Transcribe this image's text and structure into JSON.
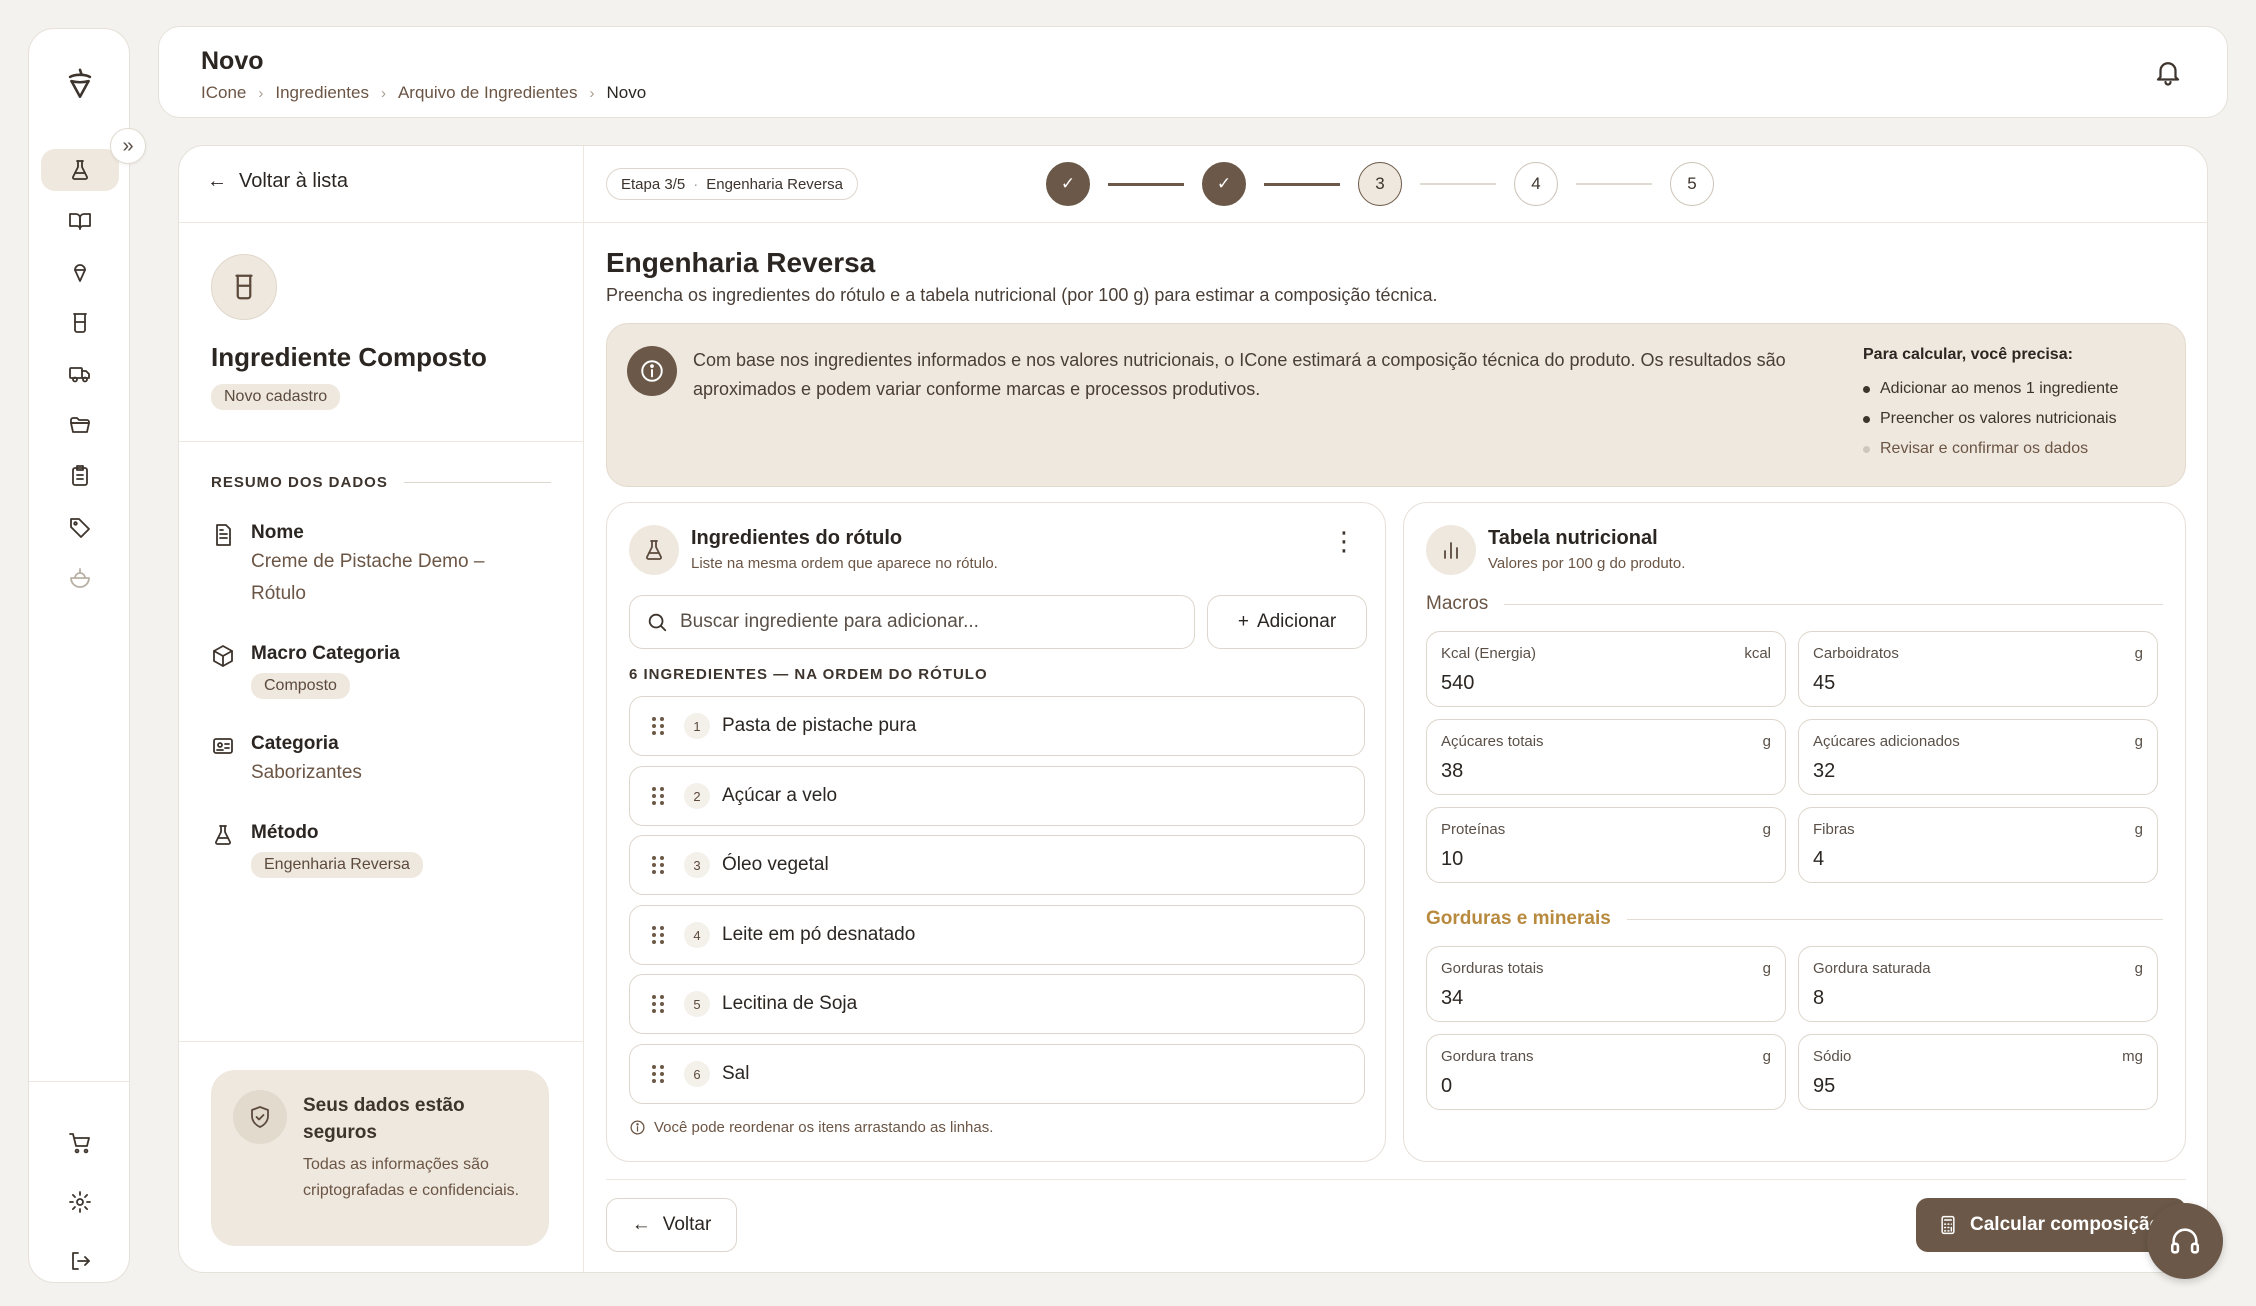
{
  "header": {
    "title": "Novo",
    "breadcrumb": [
      "ICone",
      "Ingredientes",
      "Arquivo de Ingredientes",
      "Novo"
    ]
  },
  "left_panel": {
    "back_label": "Voltar à lista",
    "title": "Ingrediente Composto",
    "status_pill": "Novo cadastro",
    "summary_heading": "RESUMO DOS DADOS",
    "summary": {
      "name_label": "Nome",
      "name_value": "Creme de Pistache Demo – Rótulo",
      "macro_label": "Macro Categoria",
      "macro_value": "Composto",
      "category_label": "Categoria",
      "category_value": "Saborizantes",
      "method_label": "Método",
      "method_value": "Engenharia Reversa"
    },
    "secure": {
      "title": "Seus dados estão seguros",
      "description": "Todas as informações são criptografadas e confidenciais."
    }
  },
  "stepper": {
    "stage": "Etapa 3/5",
    "stage_name": "Engenharia Reversa",
    "steps": [
      "3",
      "4",
      "5"
    ]
  },
  "content": {
    "title": "Engenharia Reversa",
    "subtitle": "Preencha os ingredientes do rótulo e a tabela nutricional (por 100 g) para estimar a composição técnica.",
    "info_text": "Com base nos ingredientes informados e nos valores nutricionais, o ICone estimará a composição técnica do produto. Os resultados são aproximados e podem variar conforme marcas e processos produtivos.",
    "requirements_title": "Para calcular, você precisa:",
    "requirements": [
      "Adicionar ao menos 1 ingrediente",
      "Preencher os valores nutricionais",
      "Revisar e confirmar os dados"
    ]
  },
  "ingredients": {
    "title": "Ingredientes do rótulo",
    "subtitle": "Liste na mesma ordem que aparece no rótulo.",
    "search_placeholder": "Buscar ingrediente para adicionar...",
    "add_label": "Adicionar",
    "count_label": "6 INGREDIENTES — NA ORDEM DO RÓTULO",
    "items": [
      {
        "n": "1",
        "name": "Pasta de pistache pura"
      },
      {
        "n": "2",
        "name": "Açúcar a velo"
      },
      {
        "n": "3",
        "name": "Óleo vegetal"
      },
      {
        "n": "4",
        "name": "Leite em pó desnatado"
      },
      {
        "n": "5",
        "name": "Lecitina de Soja"
      },
      {
        "n": "6",
        "name": "Sal"
      }
    ],
    "hint": "Você pode reordenar os itens arrastando as linhas."
  },
  "nutrition": {
    "title": "Tabela nutricional",
    "subtitle": "Valores por 100 g do produto.",
    "macros_title": "Macros",
    "minerals_title": "Gorduras e minerais",
    "macros": [
      {
        "label": "Kcal (Energia)",
        "unit": "kcal",
        "value": "540"
      },
      {
        "label": "Carboidratos",
        "unit": "g",
        "value": "45"
      },
      {
        "label": "Açúcares totais",
        "unit": "g",
        "value": "38"
      },
      {
        "label": "Açúcares adicionados",
        "unit": "g",
        "value": "32"
      },
      {
        "label": "Proteínas",
        "unit": "g",
        "value": "10"
      },
      {
        "label": "Fibras",
        "unit": "g",
        "value": "4"
      }
    ],
    "minerals": [
      {
        "label": "Gorduras totais",
        "unit": "g",
        "value": "34"
      },
      {
        "label": "Gordura saturada",
        "unit": "g",
        "value": "8"
      },
      {
        "label": "Gordura trans",
        "unit": "g",
        "value": "0"
      },
      {
        "label": "Sódio",
        "unit": "mg",
        "value": "95"
      }
    ]
  },
  "footer": {
    "back_label": "Voltar",
    "calc_label": "Calcular composição"
  },
  "colors": {
    "accent": "#6b5848",
    "surface_tint": "#efe8de",
    "highlight": "#b88a3e"
  }
}
